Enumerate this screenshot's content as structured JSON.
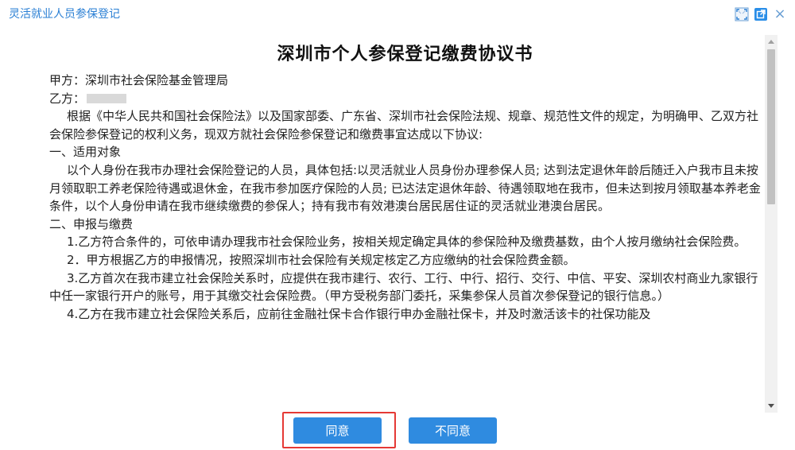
{
  "window": {
    "title": "灵活就业人员参保登记",
    "controls": [
      {
        "name": "fullscreen-icon"
      },
      {
        "name": "popout-icon"
      },
      {
        "name": "close-icon",
        "glyph": "×"
      }
    ],
    "accent_color": "#2a7fd4"
  },
  "document": {
    "title": "深圳市个人参保登记缴费协议书",
    "party_a": "甲方：深圳市社会保险基金管理局",
    "party_b_label": "乙方：",
    "intro": "根据《中华人民共和国社会保险法》以及国家部委、广东省、深圳市社会保险法规、规章、规范性文件的规定，为明确甲、乙双方社会保险参保登记的权利义务，现双方就社会保险参保登记和缴费事宜达成以下协议:",
    "section1_heading": "一、适用对象",
    "section1_body": "以个人身份在我市办理社会保险登记的人员，具体包括:以灵活就业人员身份办理参保人员; 达到法定退休年龄后随迁入户我市且未按月领取职工养老保险待遇或退休金，在我市参加医疗保险的人员; 已达法定退休年龄、待遇领取地在我市，但未达到按月领取基本养老金条件，以个人身份申请在我市继续缴费的参保人；持有我市有效港澳台居民居住证的灵活就业港澳台居民。",
    "section2_heading": "二、申报与缴费",
    "clause1": "1.乙方符合条件的，可依申请办理我市社会保险业务，按相关规定确定具体的参保险种及缴费基数，由个人按月缴纳社会保险费。",
    "clause2": "2．甲方根据乙方的申报情况，按照深圳市社会保险有关规定核定乙方应缴纳的社会保险费金额。",
    "clause3": "3.乙方首次在我市建立社会保险关系时，应提供在我市建行、农行、工行、中行、招行、交行、中信、平安、深圳农村商业九家银行中任一家银行开户的账号，用于其缴交社会保险费。（甲方受税务部门委托，采集参保人员首次参保登记的银行信息。）",
    "clause4": "4.乙方在我市建立社会保险关系后，应前往金融社保卡合作银行申办金融社保卡，并及时激活该卡的社保功能及"
  },
  "buttons": {
    "agree": "同意",
    "disagree": "不同意",
    "button_color": "#2f8be0",
    "highlight_color": "#e53935"
  }
}
